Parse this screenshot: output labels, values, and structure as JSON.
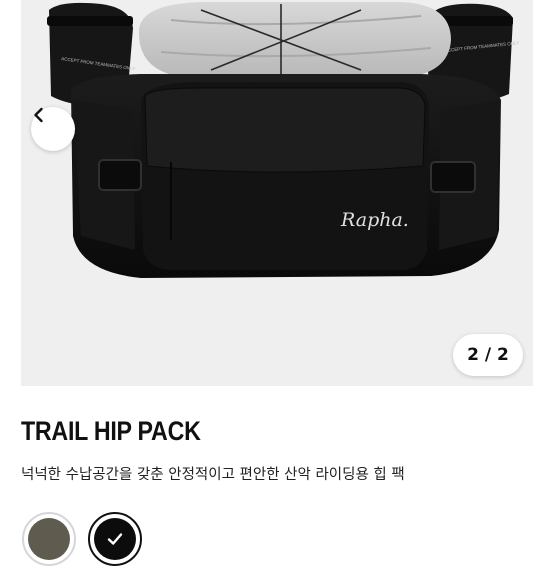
{
  "product": {
    "title": "TRAIL HIP PACK",
    "description": "넉넉한 수납공간을 갖춘 안정적이고 편안한 산악 라이딩용 힙 팩",
    "image": {
      "subject": "Black Rapha Trail Hip Pack with two black water bottles and a grey jacket strapped on top",
      "brand_logo_text": "Rapha.",
      "bottle_text": "ACCEPT FROM TEAMMATES ONLY"
    }
  },
  "gallery": {
    "current": "2",
    "total": "2",
    "counter_text": "2 / 2",
    "prev_icon": "chevron-left-icon"
  },
  "colors": {
    "swatches": [
      {
        "name": "olive",
        "hex": "#5f5c4f",
        "selected": false
      },
      {
        "name": "black",
        "hex": "#0c0c0c",
        "selected": true
      }
    ],
    "selected_icon": "check-icon"
  }
}
